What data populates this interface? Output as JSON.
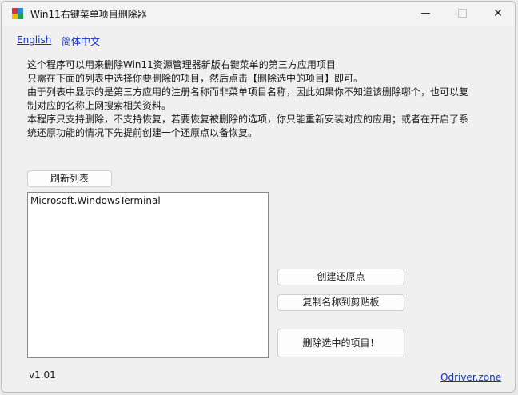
{
  "window": {
    "title": "Win11右键菜单项目删除器",
    "icon": "app-grid-icon",
    "icon_colors": [
      "#d13438",
      "#2b88d8",
      "#f7b900",
      "#1ea446"
    ]
  },
  "languages": {
    "english": "English",
    "chinese": "简体中文"
  },
  "description": {
    "lines": [
      "这个程序可以用来删除Win11资源管理器新版右键菜单的第三方应用项目",
      "只需在下面的列表中选择你要删除的项目，然后点击【删除选中的项目】即可。",
      "由于列表中显示的是第三方应用的注册名称而非菜单项目名称，因此如果你不知道该删除哪个，也可以复",
      "制对应的名称上网搜索相关资料。",
      "本程序只支持删除，不支持恢复，若要恢复被删除的选项，你只能重新安装对应的应用；或者在开启了系",
      "统还原功能的情况下先提前创建一个还原点以备恢复。"
    ]
  },
  "buttons": {
    "refresh": "刷新列表",
    "create_restore_point": "创建还原点",
    "copy_name": "复制名称到剪贴板",
    "delete_selected": "删除选中的项目！"
  },
  "list": {
    "items": [
      "Microsoft.WindowsTerminal"
    ]
  },
  "footer": {
    "version": "v1.01",
    "site": "Odriver.zone"
  },
  "colors": {
    "link": "#1530c9",
    "window_bg": "#f0f0f0"
  }
}
